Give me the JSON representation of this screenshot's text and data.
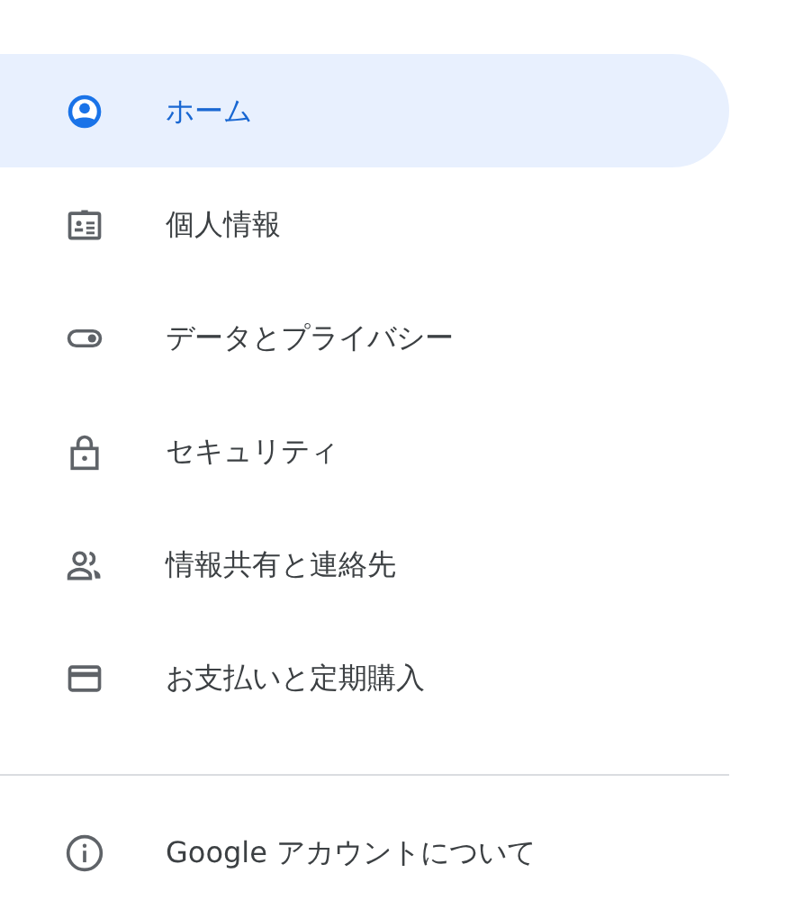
{
  "nav": {
    "items": [
      {
        "label": "ホーム",
        "selected": true
      },
      {
        "label": "個人情報",
        "selected": false
      },
      {
        "label": "データとプライバシー",
        "selected": false
      },
      {
        "label": "セキュリティ",
        "selected": false
      },
      {
        "label": "情報共有と連絡先",
        "selected": false
      },
      {
        "label": "お支払いと定期購入",
        "selected": false
      }
    ]
  },
  "footer": {
    "label": "Google アカウントについて"
  }
}
